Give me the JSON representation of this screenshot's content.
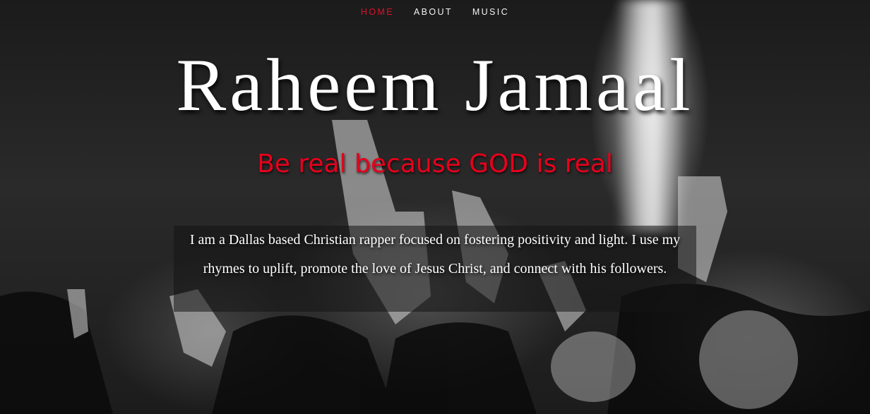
{
  "nav": {
    "items": [
      {
        "label": "HOME",
        "active": true
      },
      {
        "label": "ABOUT",
        "active": false
      },
      {
        "label": "MUSIC",
        "active": false
      }
    ]
  },
  "hero": {
    "title": "Raheem Jamaal",
    "tagline": "Be real because GOD is real",
    "bio": "I am a Dallas based Christian rapper focused on fostering positivity and light. I use my rhymes to uplift, promote the love of Jesus Christ, and connect with his followers."
  },
  "colors": {
    "accent": "#e0102a",
    "tagline": "#e8001c",
    "text": "#ffffff"
  }
}
